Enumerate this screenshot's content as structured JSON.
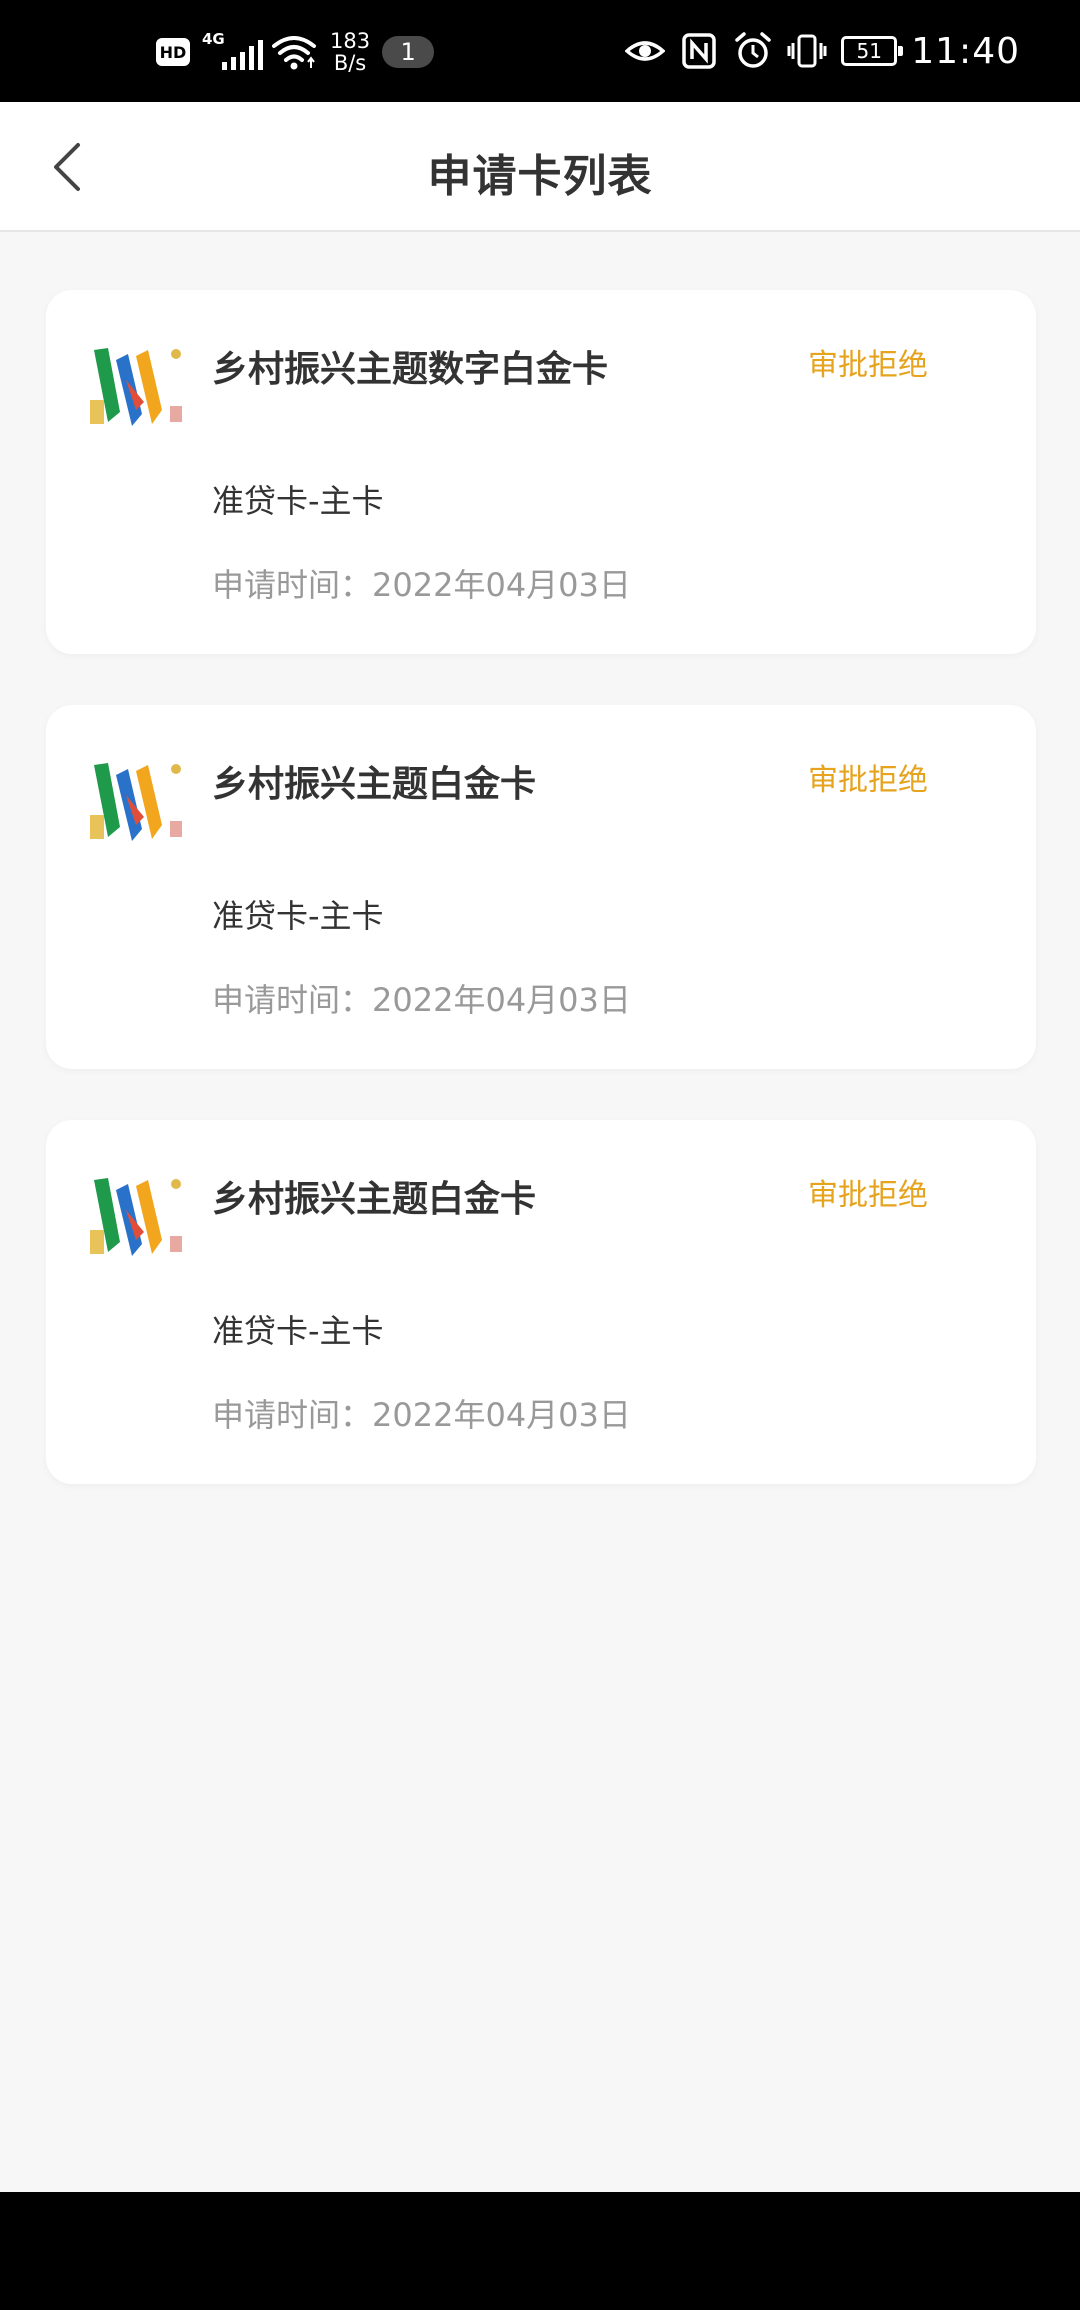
{
  "status_bar": {
    "hd": "HD",
    "network": "4G",
    "speed_value": "183",
    "speed_unit": "B/s",
    "notification_count": "1",
    "battery": "51",
    "time": "11:40"
  },
  "header": {
    "title": "申请卡列表"
  },
  "cards": [
    {
      "name": "乡村振兴主题数字白金卡",
      "status": "审批拒绝",
      "type": "准贷卡-主卡",
      "time_label": "申请时间：",
      "date": "2022年04月03日"
    },
    {
      "name": "乡村振兴主题白金卡",
      "status": "审批拒绝",
      "type": "准贷卡-主卡",
      "time_label": "申请时间：",
      "date": "2022年04月03日"
    },
    {
      "name": "乡村振兴主题白金卡",
      "status": "审批拒绝",
      "type": "准贷卡-主卡",
      "time_label": "申请时间：",
      "date": "2022年04月03日"
    }
  ],
  "colors": {
    "status_rejected": "#e6a31e",
    "page_background": "#f7f7f7",
    "title_text": "#333333",
    "secondary_text": "#999999"
  },
  "icons": {
    "back": "chevron-left-icon",
    "card_thumbnail": "rural-revitalization-card-art"
  }
}
